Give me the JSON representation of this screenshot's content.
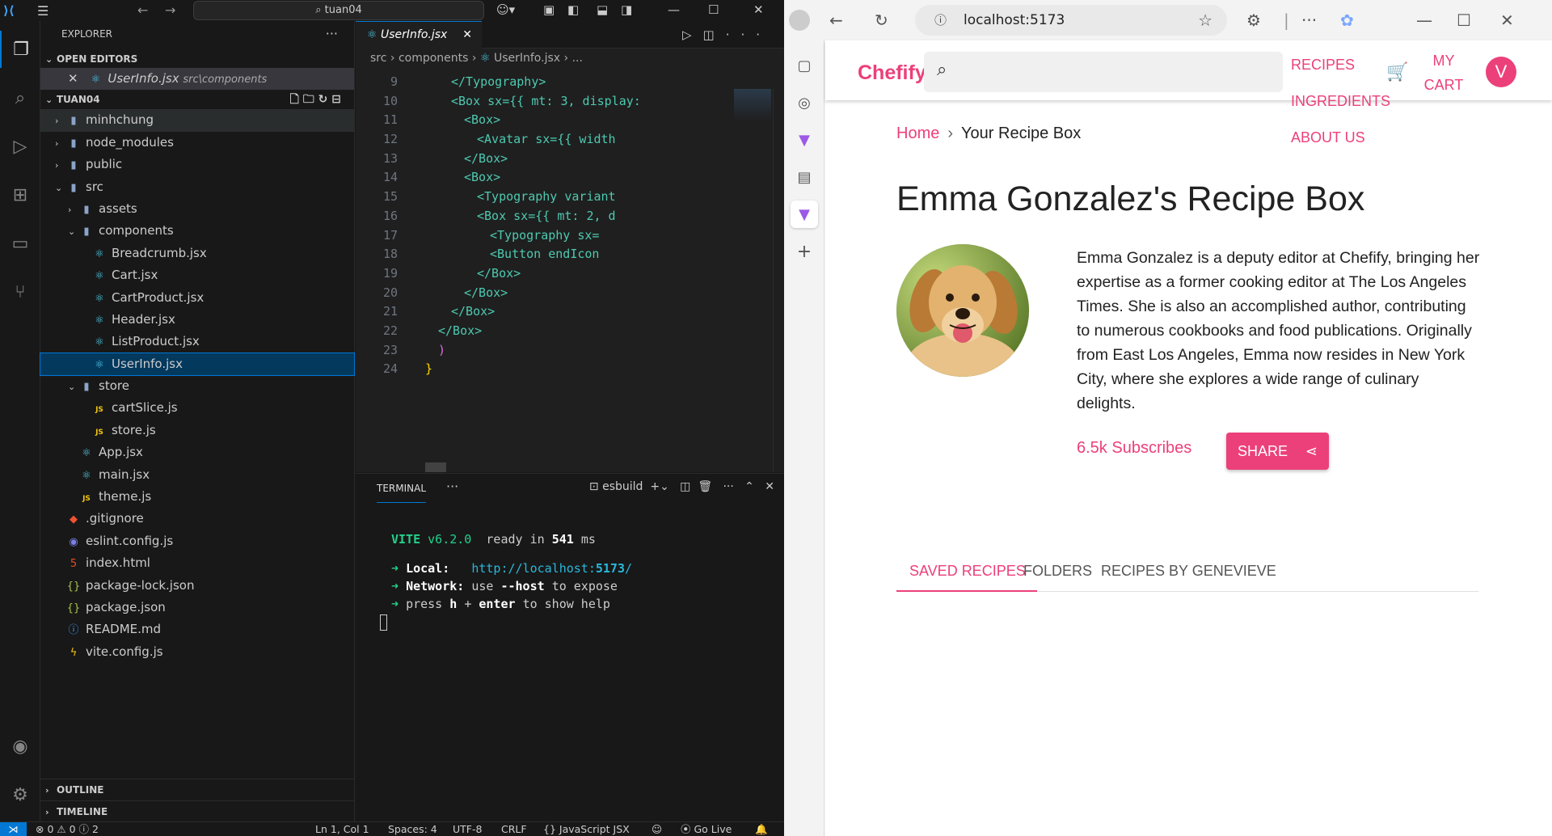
{
  "vscode": {
    "title_search": "tuan04",
    "explorer": {
      "title": "EXPLORER",
      "open_editors_label": "OPEN EDITORS",
      "open_editor": {
        "name": "UserInfo.jsx",
        "path": "src\\components"
      },
      "project_label": "TUAN04",
      "tree": [
        {
          "label": "minhchung",
          "kind": "folder",
          "depth": 0,
          "open": false
        },
        {
          "label": "node_modules",
          "kind": "folder",
          "depth": 0,
          "open": false
        },
        {
          "label": "public",
          "kind": "folder",
          "depth": 0,
          "open": false
        },
        {
          "label": "src",
          "kind": "folder",
          "depth": 0,
          "open": true
        },
        {
          "label": "assets",
          "kind": "folder",
          "depth": 1,
          "open": false
        },
        {
          "label": "components",
          "kind": "folder",
          "depth": 1,
          "open": true
        },
        {
          "label": "Breadcrumb.jsx",
          "kind": "jsx",
          "depth": 2
        },
        {
          "label": "Cart.jsx",
          "kind": "jsx",
          "depth": 2
        },
        {
          "label": "CartProduct.jsx",
          "kind": "jsx",
          "depth": 2
        },
        {
          "label": "Header.jsx",
          "kind": "jsx",
          "depth": 2
        },
        {
          "label": "ListProduct.jsx",
          "kind": "jsx",
          "depth": 2
        },
        {
          "label": "UserInfo.jsx",
          "kind": "jsx",
          "depth": 2,
          "selected": true
        },
        {
          "label": "store",
          "kind": "folder",
          "depth": 1,
          "open": true
        },
        {
          "label": "cartSlice.js",
          "kind": "js",
          "depth": 2
        },
        {
          "label": "store.js",
          "kind": "js",
          "depth": 2
        },
        {
          "label": "App.jsx",
          "kind": "jsx",
          "depth": 1
        },
        {
          "label": "main.jsx",
          "kind": "jsx",
          "depth": 1
        },
        {
          "label": "theme.js",
          "kind": "js",
          "depth": 1
        },
        {
          "label": ".gitignore",
          "kind": "git",
          "depth": 0
        },
        {
          "label": "eslint.config.js",
          "kind": "eslint",
          "depth": 0
        },
        {
          "label": "index.html",
          "kind": "html",
          "depth": 0
        },
        {
          "label": "package-lock.json",
          "kind": "json",
          "depth": 0
        },
        {
          "label": "package.json",
          "kind": "json",
          "depth": 0
        },
        {
          "label": "README.md",
          "kind": "info",
          "depth": 0
        },
        {
          "label": "vite.config.js",
          "kind": "vite",
          "depth": 0
        }
      ],
      "outline_label": "OUTLINE",
      "timeline_label": "TIMELINE"
    },
    "editor": {
      "tab_label": "UserInfo.jsx",
      "breadcrumb": [
        "src",
        "components",
        "UserInfo.jsx",
        "..."
      ],
      "lines": [
        {
          "n": "9",
          "indent": 4,
          "html": "</Typography>"
        },
        {
          "n": "10",
          "indent": 4,
          "html": "<Box sx={{ mt: 3, display:"
        },
        {
          "n": "11",
          "indent": 6,
          "html": "<Box>"
        },
        {
          "n": "12",
          "indent": 8,
          "html": "<Avatar sx={{ width"
        },
        {
          "n": "13",
          "indent": 6,
          "html": "</Box>"
        },
        {
          "n": "14",
          "indent": 6,
          "html": "<Box>"
        },
        {
          "n": "15",
          "indent": 8,
          "html": "<Typography variant"
        },
        {
          "n": "16",
          "indent": 8,
          "html": "<Box sx={{ mt: 2, d"
        },
        {
          "n": "17",
          "indent": 10,
          "html": "<Typography sx="
        },
        {
          "n": "18",
          "indent": 10,
          "html": "<Button endIcon"
        },
        {
          "n": "19",
          "indent": 8,
          "html": "</Box>"
        },
        {
          "n": "20",
          "indent": 6,
          "html": "</Box>"
        },
        {
          "n": "21",
          "indent": 4,
          "html": "</Box>"
        },
        {
          "n": "22",
          "indent": 2,
          "html": "</Box>"
        },
        {
          "n": "23",
          "indent": 2,
          "html": ")"
        },
        {
          "n": "24",
          "indent": 0,
          "html": "}"
        }
      ]
    },
    "terminal": {
      "tab_label": "TERMINAL",
      "shell_label": "esbuild",
      "vite_name": "VITE",
      "vite_version": "v6.2.0",
      "ready_text": "ready in",
      "ready_ms": "541",
      "ms": "ms",
      "local_label": "Local:",
      "local_url": "http://localhost:",
      "local_port": "5173",
      "network_label": "Network:",
      "network_text_1": "use",
      "network_flag": "--host",
      "network_text_2": "to expose",
      "help_1": "press",
      "help_key": "h",
      "help_plus": "+",
      "help_enter": "enter",
      "help_2": "to show help"
    },
    "status": {
      "errors": "0",
      "warnings": "0",
      "ports": "2",
      "position": "Ln 1, Col 1",
      "spaces": "Spaces: 4",
      "encoding": "UTF-8",
      "eol": "CRLF",
      "language": "JavaScript JSX",
      "golive": "Go Live"
    }
  },
  "browser": {
    "url": "localhost:5173",
    "site": {
      "brand": "Chefify",
      "nav": [
        "RECIPES",
        "INGREDIENTS",
        "ABOUT US"
      ],
      "cart_label_1": "MY",
      "cart_label_2": "CART",
      "avatar_letter": "V",
      "breadcrumb_home": "Home",
      "breadcrumb_current": "Your Recipe Box",
      "heading": "Emma Gonzalez's Recipe Box",
      "bio": "Emma Gonzalez is a deputy editor at Chefify, bringing her expertise as a former cooking editor at The Los Angeles Times. She is also an accomplished author, contributing to numerous cookbooks and food publications. Originally from East Los Angeles, Emma now resides in New York City, where she explores a wide range of culinary delights.",
      "subscribers": "6.5k Subscribes",
      "share_label": "SHARE",
      "tabs": [
        "SAVED RECIPES",
        "FOLDERS",
        "RECIPES BY GENEVIEVE"
      ]
    },
    "accent": "#ec407a"
  }
}
